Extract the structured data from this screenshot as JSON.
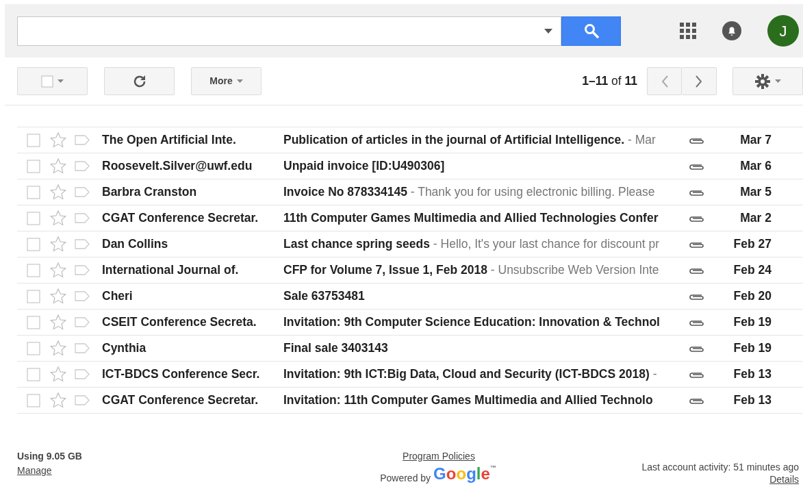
{
  "profile": {
    "initial": "J"
  },
  "toolbar": {
    "more": "More",
    "range": "1–11",
    "of": "of",
    "total": "11"
  },
  "messages": [
    {
      "sender": "The Open Artificial Inte.",
      "subject": "Publication of articles in the journal of Artificial Intelligence.",
      "snippet": "- Mar",
      "date": "Mar 7",
      "unread": true,
      "checked": false,
      "starred": false,
      "attachment": true
    },
    {
      "sender": "Roosevelt.Silver@uwf.edu",
      "subject": "Unpaid invoice [ID:U490306]",
      "date": "Mar 6",
      "unread": true,
      "checked": false,
      "starred": false,
      "attachment": true
    },
    {
      "sender": "Barbra Cranston",
      "subject": "Invoice No 878334145",
      "snippet": "- Thank you for using electronic billing. Please",
      "date": "Mar 5",
      "unread": true,
      "checked": false,
      "starred": false,
      "attachment": true
    },
    {
      "sender": "CGAT Conference Secretar.",
      "subject": "11th Computer Games Multimedia and Allied Technologies Confer",
      "date": "Mar 2",
      "unread": true,
      "checked": false,
      "starred": false,
      "attachment": true
    },
    {
      "sender": "Dan Collins",
      "subject": "Last chance spring seeds",
      "snippet": "- Hello, It's your last chance for discount pr",
      "date": "Feb 27",
      "unread": true,
      "checked": false,
      "starred": false,
      "attachment": true
    },
    {
      "sender": "International Journal of.",
      "subject": "CFP for Volume 7, Issue 1, Feb 2018",
      "snippet": "- Unsubscribe Web Version Inte",
      "date": "Feb 24",
      "unread": true,
      "checked": false,
      "starred": false,
      "attachment": true
    },
    {
      "sender": "Cheri",
      "subject": "Sale 63753481",
      "date": "Feb 20",
      "unread": true,
      "checked": false,
      "starred": false,
      "attachment": true
    },
    {
      "sender": "CSEIT Conference Secreta.",
      "subject": "Invitation: 9th Computer Science Education: Innovation & Technol",
      "date": "Feb 19",
      "unread": true,
      "checked": false,
      "starred": false,
      "attachment": true
    },
    {
      "sender": "Cynthia",
      "subject": "Final sale 3403143",
      "date": "Feb 19",
      "unread": true,
      "checked": false,
      "starred": false,
      "attachment": true
    },
    {
      "sender": "ICT-BDCS Conference Secr.",
      "subject": "Invitation: 9th ICT:Big Data, Cloud and Security (ICT-BDCS 2018)",
      "snippet": "-",
      "date": "Feb 13",
      "unread": true,
      "checked": false,
      "starred": false,
      "attachment": true
    },
    {
      "sender": "CGAT Conference Secretar.",
      "subject": "Invitation: 11th Computer Games Multimedia and Allied Technolo",
      "date": "Feb 13",
      "unread": true,
      "checked": false,
      "starred": false,
      "attachment": true
    }
  ],
  "footer": {
    "storage": "Using 9.05 GB",
    "manage": "Manage",
    "policies": "Program Policies",
    "powered_by": "Powered by",
    "brand": "Google",
    "trademark": "™",
    "activity": "Last account activity: 51 minutes ago",
    "details": "Details"
  }
}
